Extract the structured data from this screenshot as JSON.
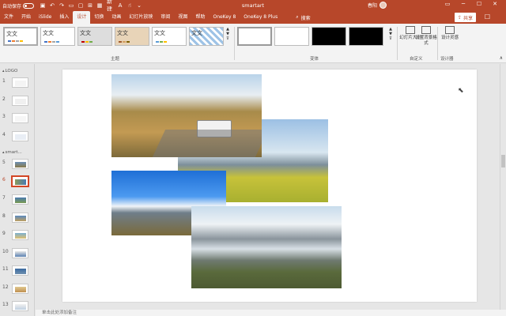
{
  "titlebar": {
    "autosave_label": "自动保存",
    "toggle_state": "关",
    "new_label": "新建",
    "doc_title": "smartart",
    "user_name": "春阳"
  },
  "tabs": [
    "文件",
    "开始",
    "iSlide",
    "插入",
    "设计",
    "切换",
    "动画",
    "幻灯片放映",
    "审阅",
    "视图",
    "帮助",
    "OneKey 8",
    "OneKey 8 Plus"
  ],
  "active_tab": "设计",
  "search_label": "搜索",
  "share_label": "共享",
  "ribbon": {
    "themes": [
      "文文",
      "文文",
      "文文",
      "文文",
      "文文",
      "文文"
    ],
    "themes_group": "主题",
    "variants_group": "变体",
    "slide_size_label": "幻灯片大小",
    "format_bg_label": "设置背景格式",
    "customize_group": "自定义",
    "design_ideas_label": "设计灵感",
    "designer_group": "设计器"
  },
  "panel": {
    "sections": [
      "LOGO",
      "smart..."
    ],
    "slide_numbers": [
      "1",
      "2",
      "3",
      "4",
      "5",
      "6",
      "7",
      "8",
      "9",
      "10",
      "11",
      "12",
      "13"
    ],
    "selected_slide": "6"
  },
  "notes_placeholder": "单击此处添加备注",
  "colors": {
    "accent": "#b7472a",
    "ribbon_bg": "#f3f3f3",
    "canvas_bg": "#e6e6e6"
  }
}
